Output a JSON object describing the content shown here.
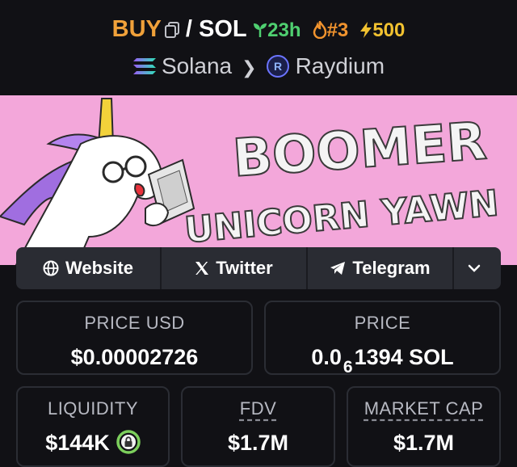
{
  "header": {
    "side": "BUY",
    "pair_separator": "/",
    "quote": "SOL",
    "age": "23h",
    "rank": "#3",
    "boost": "500",
    "chain": "Solana",
    "dex": "Raydium"
  },
  "banner": {
    "line1": "BOOMER",
    "line2": "UNICORN YAWN"
  },
  "links": {
    "website": "Website",
    "twitter": "Twitter",
    "telegram": "Telegram"
  },
  "stats": {
    "price_usd_label": "PRICE USD",
    "price_usd": "$0.00002726",
    "price_label": "PRICE",
    "price_prefix": "0.0",
    "price_zero_count": "6",
    "price_suffix": "1394 SOL",
    "liquidity_label": "LIQUIDITY",
    "liquidity": "$144K",
    "fdv_label": "FDV",
    "fdv": "$1.7M",
    "mcap_label": "MARKET CAP",
    "mcap": "$1.7M"
  },
  "colors": {
    "buy": "#f0a13a",
    "age": "#4fcf70",
    "rank": "#f0932e",
    "boost": "#f2c230",
    "banner_bg": "#f3a7da",
    "lock": "#7ccf5c"
  }
}
